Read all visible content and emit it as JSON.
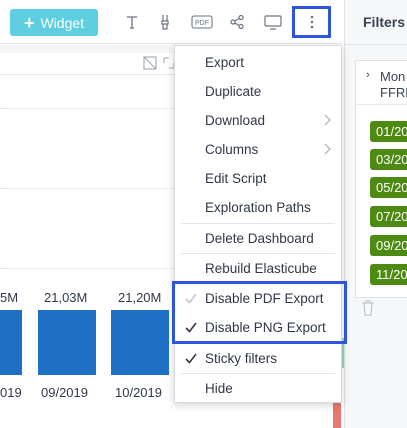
{
  "toolbar": {
    "widget_label": "Widget",
    "icons": [
      "text-icon",
      "brush-icon",
      "pdf-icon",
      "share-icon",
      "monitor-icon",
      "more-vertical-icon"
    ],
    "pdf_text": "PDF"
  },
  "chart": {
    "bar_labels": [
      "5M",
      "21,03M",
      "21,20M"
    ],
    "x_labels": [
      "019",
      "09/2019",
      "10/2019"
    ],
    "bar_color": "#1f6fc5"
  },
  "menu": {
    "items": [
      {
        "label": "Export",
        "has_submenu": false,
        "checked": false
      },
      {
        "label": "Duplicate",
        "has_submenu": false,
        "checked": false
      },
      {
        "label": "Download",
        "has_submenu": true,
        "checked": false
      },
      {
        "label": "Columns",
        "has_submenu": true,
        "checked": false
      },
      {
        "label": "Edit Script",
        "has_submenu": false,
        "checked": false
      },
      {
        "label": "Exploration Paths",
        "has_submenu": false,
        "checked": false
      },
      {
        "label": "Delete Dashboard",
        "has_submenu": false,
        "checked": false
      },
      {
        "label": "Rebuild Elasticube",
        "has_submenu": false,
        "checked": false
      },
      {
        "label": "Disable PDF Export",
        "has_submenu": false,
        "checked": "faded"
      },
      {
        "label": "Disable PNG Export",
        "has_submenu": false,
        "checked": true
      },
      {
        "label": "Sticky filters",
        "has_submenu": false,
        "checked": true
      },
      {
        "label": "Hide",
        "has_submenu": false,
        "checked": false
      }
    ]
  },
  "filters": {
    "title": "Filters",
    "card_title_line1": "Mon",
    "card_title_line2": "FFRR",
    "chips": [
      "01/20",
      "03/20",
      "05/20",
      "07/20",
      "09/20",
      "11/20"
    ],
    "chip_color": "#4d8a11"
  },
  "accent": "#2f55e0"
}
